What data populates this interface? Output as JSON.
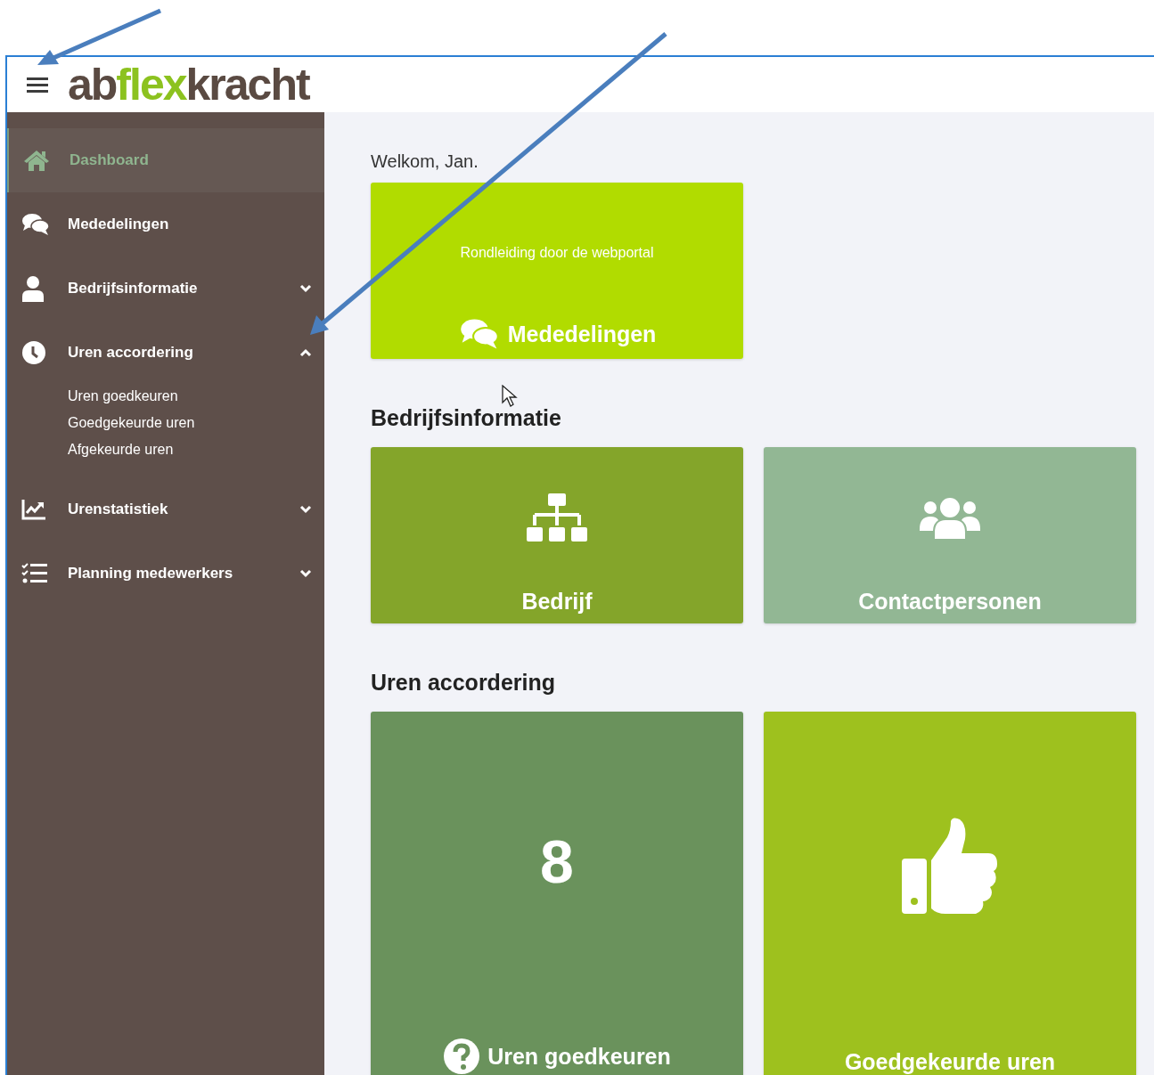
{
  "header": {
    "logo": [
      {
        "text": "ab",
        "color": "#5a4a42"
      },
      {
        "text": "flex",
        "color": "#8cc21f"
      },
      {
        "text": "kracht",
        "color": "#5a4a42"
      }
    ]
  },
  "sidebar": {
    "items": [
      {
        "label": "Dashboard",
        "selected": true
      },
      {
        "label": "Mededelingen",
        "selected": false
      },
      {
        "label": "Bedrijfsinformatie",
        "selected": false,
        "expanded": false
      },
      {
        "label": "Uren accordering",
        "selected": false,
        "expanded": true,
        "children": [
          {
            "label": "Uren goedkeuren"
          },
          {
            "label": "Goedgekeurde uren"
          },
          {
            "label": "Afgekeurde uren"
          }
        ]
      },
      {
        "label": "Urenstatistiek",
        "selected": false,
        "expanded": false
      },
      {
        "label": "Planning medewerkers",
        "selected": false,
        "expanded": false
      }
    ]
  },
  "welcome": "Welkom, Jan.",
  "sections": [
    {
      "tiles": [
        {
          "kind": "tour",
          "subtitle": "Rondleiding door de webportal",
          "label": "Mededelingen",
          "color": "#b1dc00"
        }
      ]
    },
    {
      "heading": "Bedrijfsinformatie",
      "tiles": [
        {
          "kind": "icon",
          "label": "Bedrijf",
          "color": "#84a52a"
        },
        {
          "kind": "icon",
          "label": "Contactpersonen",
          "color": "#92b794"
        }
      ]
    },
    {
      "heading": "Uren accordering",
      "tiles": [
        {
          "kind": "count",
          "count": "8",
          "label": "Uren goedkeuren",
          "color": "#6a925c"
        },
        {
          "kind": "icon",
          "label": "Goedgekeurde uren",
          "color": "#9ec11e"
        }
      ]
    }
  ]
}
